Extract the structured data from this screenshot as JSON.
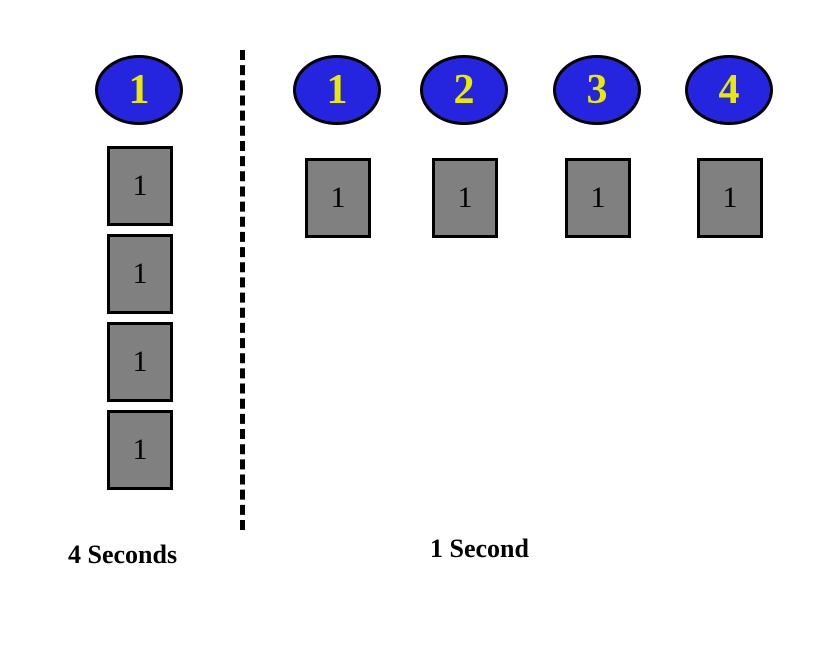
{
  "colors": {
    "ovalFill": "#2525e0",
    "ovalStroke": "#000000",
    "ovalText": "#eaea00",
    "blockFill": "#808080",
    "blockStroke": "#000000",
    "blockText": "#000000",
    "labelText": "#000000"
  },
  "left": {
    "oval": {
      "number": "1"
    },
    "blocks": [
      {
        "number": "1"
      },
      {
        "number": "1"
      },
      {
        "number": "1"
      },
      {
        "number": "1"
      }
    ],
    "label": "4 Seconds"
  },
  "right": {
    "columns": [
      {
        "oval": "1",
        "block": "1"
      },
      {
        "oval": "2",
        "block": "1"
      },
      {
        "oval": "3",
        "block": "1"
      },
      {
        "oval": "4",
        "block": "1"
      }
    ],
    "label": "1 Second"
  },
  "fontSizes": {
    "oval": "42px",
    "block": "30px",
    "label": "26px"
  }
}
